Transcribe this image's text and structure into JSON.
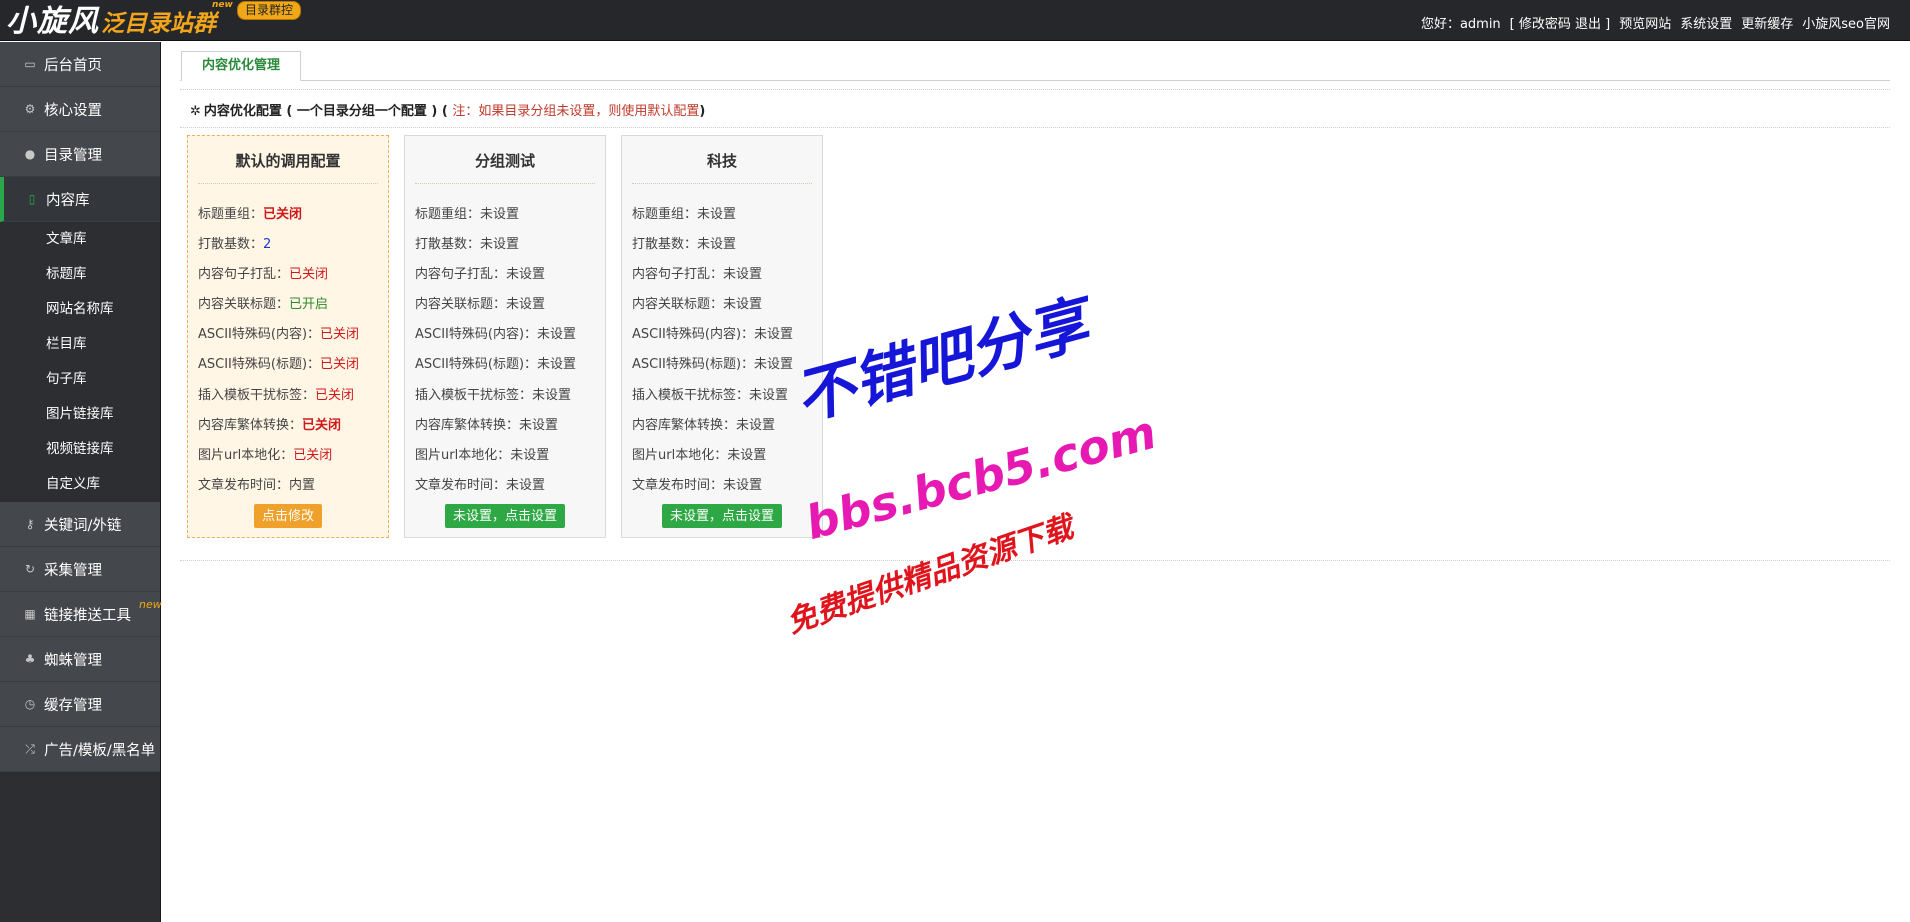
{
  "header": {
    "logo_main": "小旋风",
    "logo_sub": "泛目录站群",
    "logo_new": "new",
    "logo_badge": "目录群控",
    "greeting": "您好：admin",
    "account_links": "[ 修改密码 退出 ]",
    "links": [
      "预览网站",
      "系统设置",
      "更新缓存",
      "小旋风seo官网"
    ]
  },
  "sidebar": {
    "items": [
      {
        "label": "后台首页",
        "icon": "monitor-icon",
        "glyph": "▭"
      },
      {
        "label": "核心设置",
        "icon": "gear-icon",
        "glyph": "⚙"
      },
      {
        "label": "目录管理",
        "icon": "user-icon",
        "glyph": "●"
      },
      {
        "label": "内容库",
        "icon": "book-icon",
        "glyph": "▯",
        "active": true
      }
    ],
    "sub_items": [
      "文章库",
      "标题库",
      "网站名称库",
      "栏目库",
      "句子库",
      "图片链接库",
      "视频链接库",
      "自定义库"
    ],
    "items_after": [
      {
        "label": "关键词/外链",
        "icon": "key-icon",
        "glyph": "⚷"
      },
      {
        "label": "采集管理",
        "icon": "refresh-icon",
        "glyph": "↻"
      },
      {
        "label": "链接推送工具",
        "icon": "windows-icon",
        "glyph": "▦",
        "badge": "new"
      },
      {
        "label": "蜘蛛管理",
        "icon": "android-icon",
        "glyph": "♣"
      },
      {
        "label": "缓存管理",
        "icon": "stopwatch-icon",
        "glyph": "◷"
      },
      {
        "label": "广告/模板/黑名单",
        "icon": "shuffle-icon",
        "glyph": "⤮"
      }
    ]
  },
  "main": {
    "tab": "内容优化管理",
    "section_title": "内容优化配置 ( 一个目录分组一个配置 ) (",
    "section_note": "注：如果目录分组未设置，则使用默认配置",
    "section_close": ")",
    "cards": [
      {
        "title": "默认的调用配置",
        "rows": [
          {
            "label": "标题重组：",
            "value": "已关闭",
            "style": "val-off-b"
          },
          {
            "label": "打散基数：",
            "value": "2",
            "style": "val-num"
          },
          {
            "label": "内容句子打乱：",
            "value": "已关闭",
            "style": "val-off"
          },
          {
            "label": "内容关联标题：",
            "value": "已开启",
            "style": "val-on"
          },
          {
            "label": "ASCII特殊码(内容)：",
            "value": "已关闭",
            "style": "val-off"
          },
          {
            "label": "ASCII特殊码(标题)：",
            "value": "已关闭",
            "style": "val-off"
          },
          {
            "label": "插入模板干扰标签：",
            "value": "已关闭",
            "style": "val-off"
          },
          {
            "label": "内容库繁体转换：",
            "value": "已关闭",
            "style": "val-off-b"
          },
          {
            "label": "图片url本地化：",
            "value": "已关闭",
            "style": "val-off"
          },
          {
            "label": "文章发布时间：",
            "value": "内置",
            "style": "val-none"
          }
        ],
        "button": "点击修改"
      },
      {
        "title": "分组测试",
        "rows": [
          {
            "label": "标题重组：",
            "value": "未设置",
            "style": "val-none"
          },
          {
            "label": "打散基数：",
            "value": "未设置",
            "style": "val-none"
          },
          {
            "label": "内容句子打乱：",
            "value": "未设置",
            "style": "val-none"
          },
          {
            "label": "内容关联标题：",
            "value": "未设置",
            "style": "val-none"
          },
          {
            "label": "ASCII特殊码(内容)：",
            "value": "未设置",
            "style": "val-none"
          },
          {
            "label": "ASCII特殊码(标题)：",
            "value": "未设置",
            "style": "val-none"
          },
          {
            "label": "插入模板干扰标签：",
            "value": "未设置",
            "style": "val-none"
          },
          {
            "label": "内容库繁体转换：",
            "value": "未设置",
            "style": "val-none"
          },
          {
            "label": "图片url本地化：",
            "value": "未设置",
            "style": "val-none"
          },
          {
            "label": "文章发布时间：",
            "value": "未设置",
            "style": "val-none"
          }
        ],
        "button": "未设置，点击设置"
      },
      {
        "title": "科技",
        "rows": [
          {
            "label": "标题重组：",
            "value": "未设置",
            "style": "val-none"
          },
          {
            "label": "打散基数：",
            "value": "未设置",
            "style": "val-none"
          },
          {
            "label": "内容句子打乱：",
            "value": "未设置",
            "style": "val-none"
          },
          {
            "label": "内容关联标题：",
            "value": "未设置",
            "style": "val-none"
          },
          {
            "label": "ASCII特殊码(内容)：",
            "value": "未设置",
            "style": "val-none"
          },
          {
            "label": "ASCII特殊码(标题)：",
            "value": "未设置",
            "style": "val-none"
          },
          {
            "label": "插入模板干扰标签：",
            "value": "未设置",
            "style": "val-none"
          },
          {
            "label": "内容库繁体转换：",
            "value": "未设置",
            "style": "val-none"
          },
          {
            "label": "图片url本地化：",
            "value": "未设置",
            "style": "val-none"
          },
          {
            "label": "文章发布时间：",
            "value": "未设置",
            "style": "val-none"
          }
        ],
        "button": "未设置，点击设置"
      }
    ]
  },
  "watermark": {
    "line1": "不错吧分享",
    "line2": "bbs.bcb5.com",
    "line3": "免费提供精品资源下载"
  }
}
